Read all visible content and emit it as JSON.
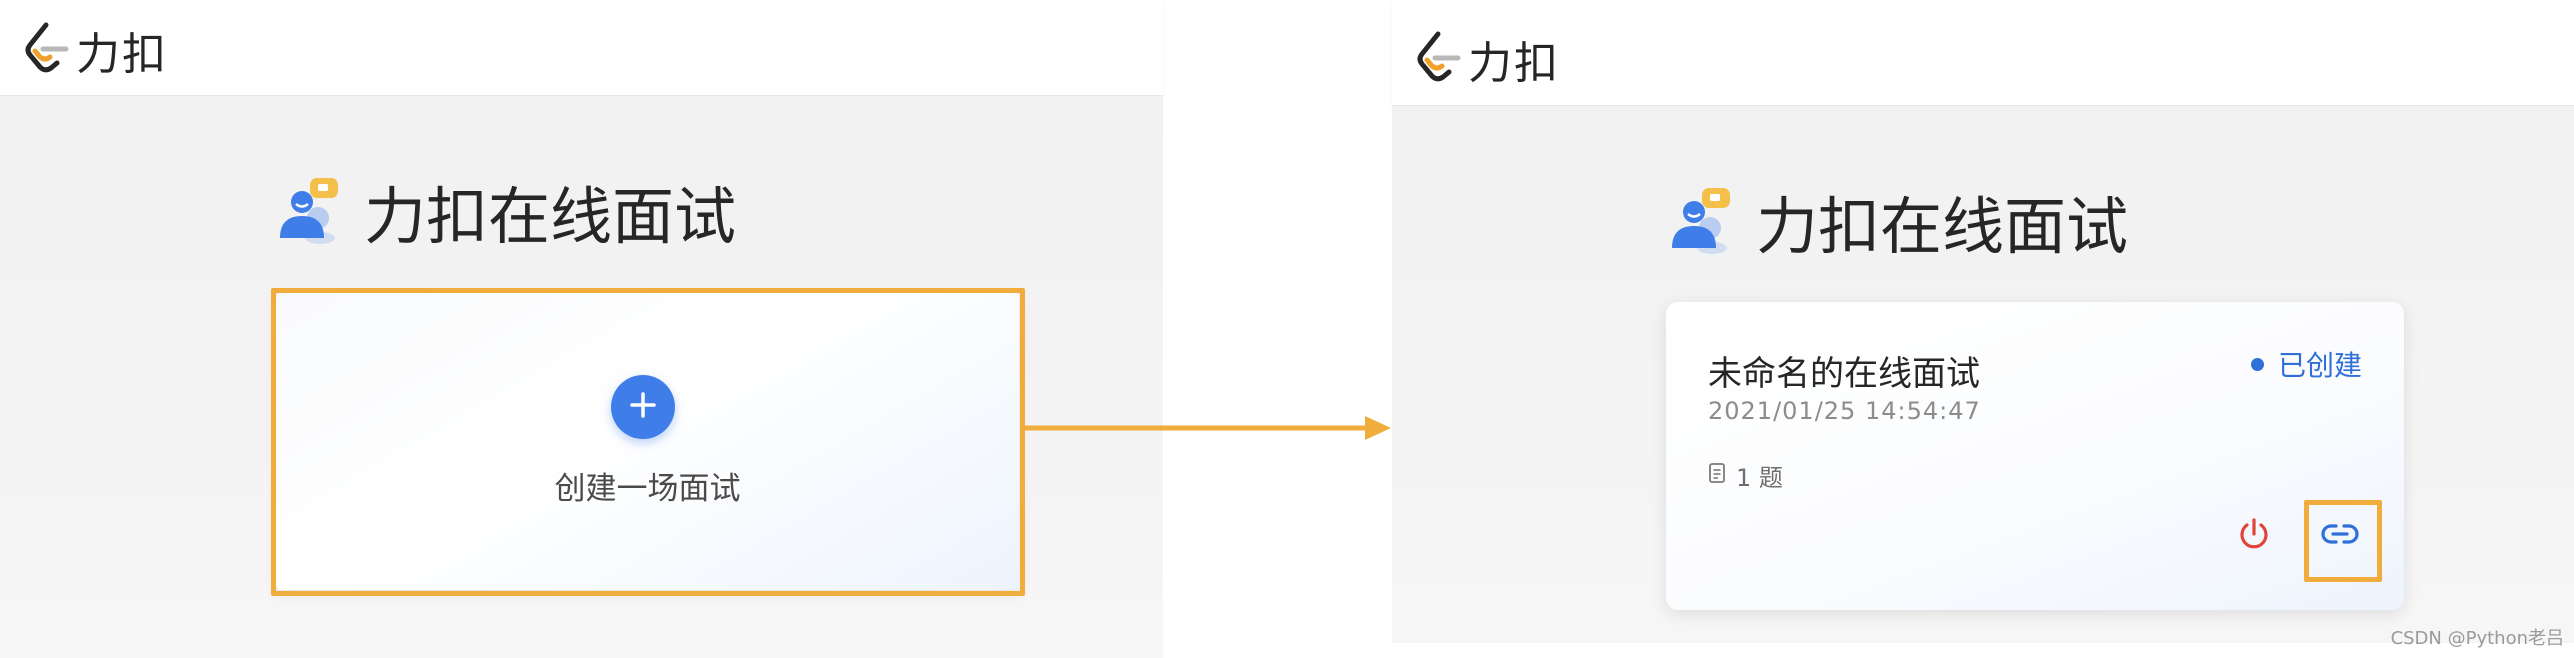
{
  "brand": {
    "name": "力扣"
  },
  "left": {
    "heading": "力扣在线面试",
    "create_card": {
      "label": "创建一场面试"
    }
  },
  "right": {
    "heading": "力扣在线面试",
    "interview": {
      "title": "未命名的在线面试",
      "timestamp": "2021/01/25 14:54:47",
      "status": "已创建",
      "question_count": "1 题"
    }
  },
  "watermark": "CSDN @Python老吕",
  "colors": {
    "accent": "#3f7ee8",
    "highlight": "#f0ad3c",
    "status": "#2f6fd8",
    "power": "#e0453a"
  },
  "icons": [
    "leetcode-logo-icon",
    "interview-avatar-icon",
    "plus-icon",
    "arrow-right-icon",
    "document-icon",
    "power-icon",
    "link-icon"
  ]
}
